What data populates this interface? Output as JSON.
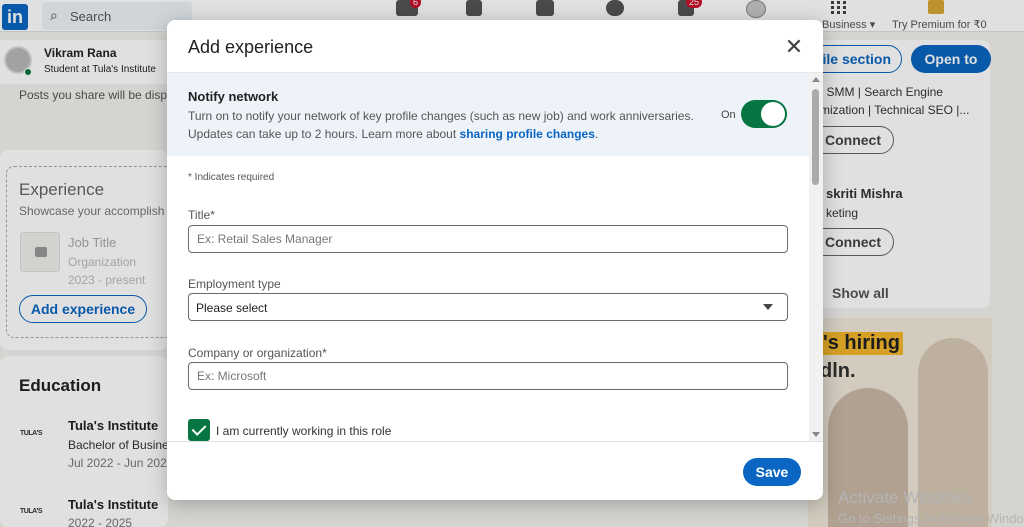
{
  "topnav": {
    "logo": "in",
    "search_placeholder": "Search",
    "home_badge": "6",
    "notifications_badge": "25",
    "business_label": "Business ▾",
    "premium_label": "Try Premium for ₹0"
  },
  "user": {
    "name": "Vikram Rana",
    "subtitle": "Student at Tula's Institute"
  },
  "feed": {
    "posts_text": "Posts you share will be disp"
  },
  "experience": {
    "title": "Experience",
    "subtitle": "Showcase your accomplish",
    "job_title": "Job Title",
    "org": "Organization",
    "dates": "2023 - present",
    "add_button": "Add experience"
  },
  "education": {
    "title": "Education",
    "items": [
      {
        "logo": "TULA'S",
        "name": "Tula's Institute",
        "degree": "Bachelor of Busine",
        "dates": "Jul 2022 - Jun 202"
      },
      {
        "logo": "TULA'S",
        "name": "Tula's Institute",
        "degree": "",
        "dates": "2022 - 2025"
      }
    ]
  },
  "sidebar_right": {
    "profile_section_button": "ile section",
    "open_to_button": "Open to",
    "person1_line1": "| SMM | Search Engine",
    "person1_line2": "mization | Technical SEO |...",
    "connect_label": "Connect",
    "person2_name": "skriti Mishra",
    "person2_sub": "keting",
    "show_all": "Show all",
    "ad_hiring": "'s hiring",
    "ad_brand": "dln."
  },
  "watermark": {
    "title": "Activate Windows",
    "subtitle": "Go to Settings to activate Windo"
  },
  "modal": {
    "title": "Add experience",
    "notify": {
      "title": "Notify network",
      "desc_prefix": "Turn on to notify your network of key profile changes (such as new job) and work anniversaries. Updates can take up to 2 hours. Learn more about ",
      "desc_link": "sharing profile changes",
      "desc_suffix": ".",
      "toggle_state": "On"
    },
    "required_note": "* Indicates required",
    "fields": {
      "title_label": "Title*",
      "title_placeholder": "Ex: Retail Sales Manager",
      "employment_label": "Employment type",
      "employment_value": "Please select",
      "company_label": "Company or organization*",
      "company_placeholder": "Ex: Microsoft"
    },
    "currently_working_label": "I am currently working in this role",
    "currently_working_checked": true,
    "save_button": "Save"
  },
  "colors": {
    "primary": "#0a66c2",
    "toggle_on": "#057642",
    "notify_bg": "#edf3f8"
  }
}
